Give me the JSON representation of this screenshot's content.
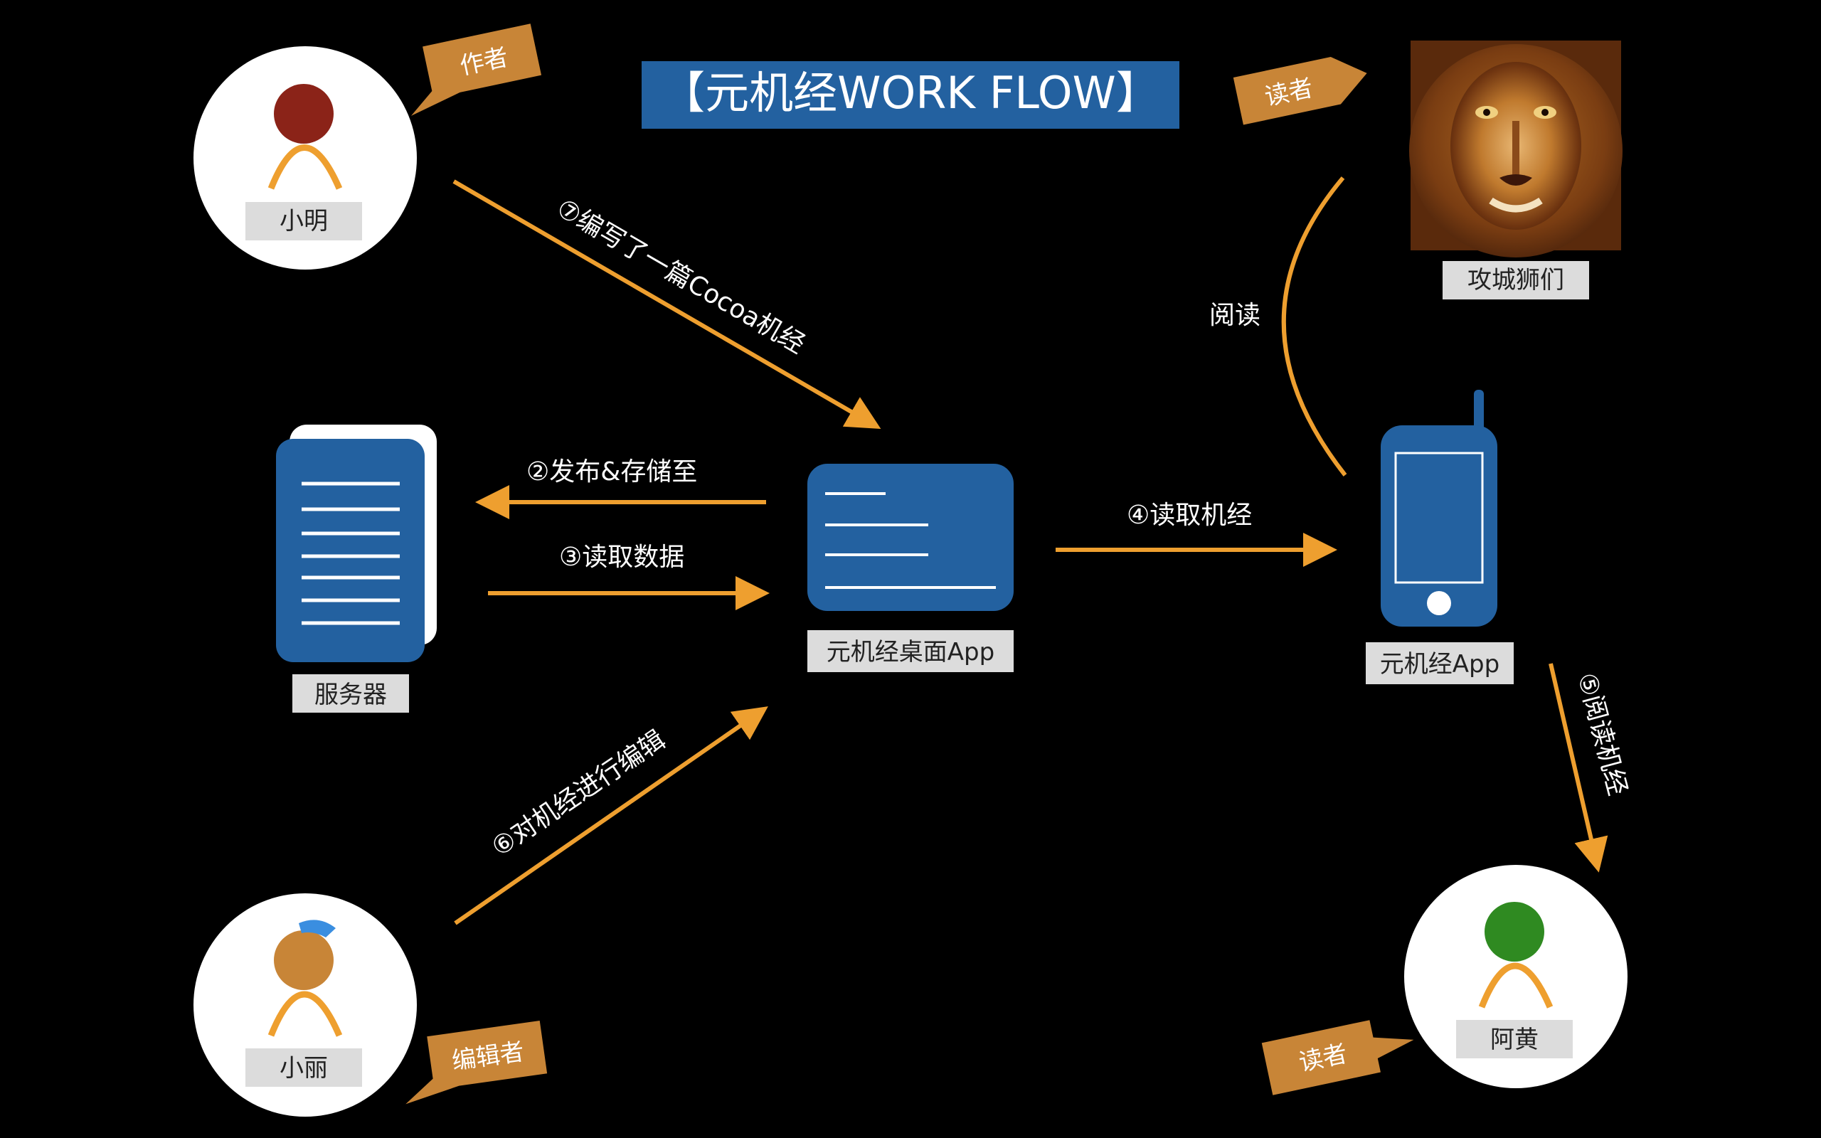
{
  "title": "【元机经WORK FLOW】",
  "colors": {
    "background": "#000000",
    "accent": "#EE9F2F",
    "tag": "#C88537",
    "blue": "#2361A0",
    "label_bg": "#DCDCDC",
    "author_head": "#8B2318",
    "editor_head": "#C88537",
    "reader_head": "#2F8A21",
    "cap": "#3A8EE0"
  },
  "nodes": {
    "author": "小明",
    "editor": "小丽",
    "reader": "阿黄",
    "lions": "攻城狮们",
    "server": "服务器",
    "desktop": "元机经桌面App",
    "mobile": "元机经App"
  },
  "tags": {
    "author": "作者",
    "reader_top": "读者",
    "editor": "编辑者",
    "reader_bottom": "读者"
  },
  "edges": {
    "step1": "⑦编写了一篇Cocoa机经",
    "step2": "②发布&存储至",
    "step3": "③读取数据",
    "step4": "④读取机经",
    "step5": "⑤阅读机经",
    "step6": "⑥对机经进行编辑",
    "read": "阅读"
  },
  "icons": {
    "lion": "lion-photo",
    "server": "server-document-icon",
    "desktop": "desktop-app-icon",
    "mobile": "mobile-phone-icon"
  }
}
